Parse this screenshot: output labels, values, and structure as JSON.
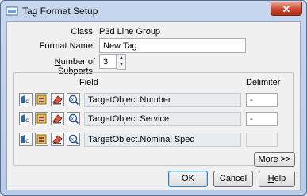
{
  "window": {
    "title": "Tag Format Setup",
    "close_label": "✕"
  },
  "form": {
    "class_label": "Class:",
    "class_value": "P3d Line Group",
    "format_name_label": "Format Name:",
    "format_name_value": "New Tag",
    "subparts_label_pre": "N",
    "subparts_label_rest": "umber of Subparts:",
    "subparts_value": "3"
  },
  "grid": {
    "field_header": "Field",
    "delimiter_header": "Delimiter",
    "rows": [
      {
        "field": "TargetObject.Number",
        "delimiter": "-"
      },
      {
        "field": "TargetObject.Service",
        "delimiter": "-"
      },
      {
        "field": "TargetObject.Nominal Spec",
        "delimiter": ""
      }
    ]
  },
  "buttons": {
    "more": "More >>",
    "ok": "OK",
    "cancel": "Cancel",
    "help_pre": "H",
    "help_rest": "elp"
  }
}
